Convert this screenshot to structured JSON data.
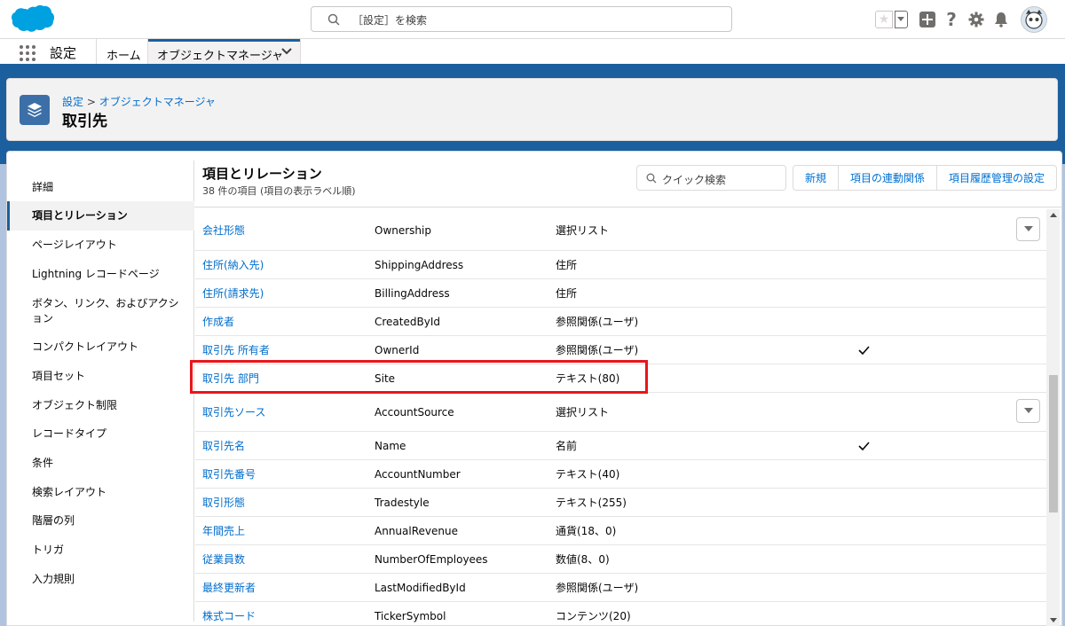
{
  "header": {
    "search_placeholder": "［設定］を検索"
  },
  "app_nav": {
    "app_name": "設定",
    "home": "ホーム",
    "active_tab": "オブジェクトマネージャ"
  },
  "page_header": {
    "breadcrumb_parent": "設定",
    "breadcrumb_sep": " > ",
    "breadcrumb_current": "オブジェクトマネージャ",
    "title": "取引先"
  },
  "left_nav": {
    "items": [
      {
        "label": "詳細"
      },
      {
        "label": "項目とリレーション"
      },
      {
        "label": "ページレイアウト"
      },
      {
        "label": "Lightning レコードページ"
      },
      {
        "label": "ボタン、リンク、およびアクシ"
      },
      {
        "label": "ョン"
      },
      {
        "label": "コンパクトレイアウト"
      },
      {
        "label": "項目セット"
      },
      {
        "label": "オブジェクト制限"
      },
      {
        "label": "レコードタイプ"
      },
      {
        "label": "条件"
      },
      {
        "label": "検索レイアウト"
      },
      {
        "label": "階層の列"
      },
      {
        "label": "トリガ"
      },
      {
        "label": "入力規則"
      }
    ]
  },
  "panel": {
    "title": "項目とリレーション",
    "subtitle": "38 件の項目 (項目の表示ラベル順)",
    "quick_search_placeholder": "クイック検索",
    "buttons": [
      "新規",
      "項目の連動関係",
      "項目履歴管理の設定"
    ]
  },
  "fields": [
    {
      "label": "会社形態",
      "api": "Ownership",
      "type": "選択リスト",
      "check": false,
      "action": true
    },
    {
      "label": "住所(納入先)",
      "api": "ShippingAddress",
      "type": "住所",
      "check": false,
      "action": false
    },
    {
      "label": "住所(請求先)",
      "api": "BillingAddress",
      "type": "住所",
      "check": false,
      "action": false
    },
    {
      "label": "作成者",
      "api": "CreatedById",
      "type": "参照関係(ユーザ)",
      "check": false,
      "action": false
    },
    {
      "label": "取引先 所有者",
      "api": "OwnerId",
      "type": "参照関係(ユーザ)",
      "check": true,
      "action": false
    },
    {
      "label": "取引先 部門",
      "api": "Site",
      "type": "テキスト(80)",
      "check": false,
      "action": false
    },
    {
      "label": "取引先ソース",
      "api": "AccountSource",
      "type": "選択リスト",
      "check": false,
      "action": true
    },
    {
      "label": "取引先名",
      "api": "Name",
      "type": "名前",
      "check": true,
      "action": false
    },
    {
      "label": "取引先番号",
      "api": "AccountNumber",
      "type": "テキスト(40)",
      "check": false,
      "action": false
    },
    {
      "label": "取引形態",
      "api": "Tradestyle",
      "type": "テキスト(255)",
      "check": false,
      "action": false
    },
    {
      "label": "年間売上",
      "api": "AnnualRevenue",
      "type": "通貨(18、0)",
      "check": false,
      "action": false
    },
    {
      "label": "従業員数",
      "api": "NumberOfEmployees",
      "type": "数値(8、0)",
      "check": false,
      "action": false
    },
    {
      "label": "最終更新者",
      "api": "LastModifiedById",
      "type": "参照関係(ユーザ)",
      "check": false,
      "action": false
    },
    {
      "label": "株式コード",
      "api": "TickerSymbol",
      "type": "コンテンツ(20)",
      "check": false,
      "action": false
    }
  ],
  "colors": {
    "brand": "#1b5f9e",
    "link": "#006dcc",
    "highlight": "#e8161b"
  }
}
